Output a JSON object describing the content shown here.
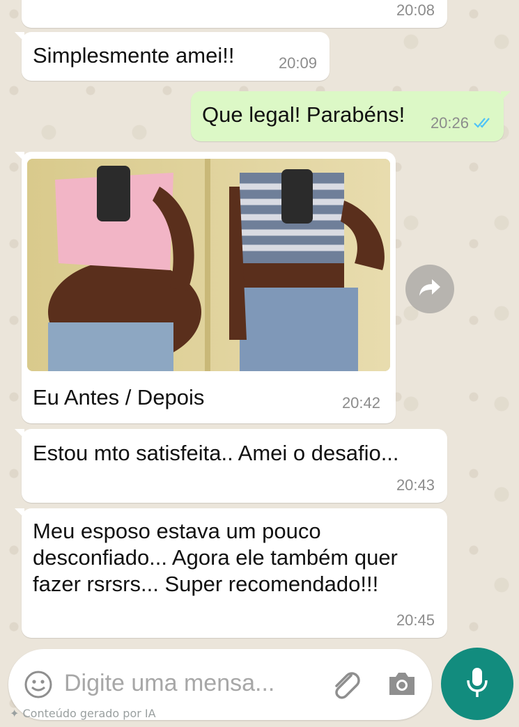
{
  "messages": [
    {
      "text": "",
      "time": "20:08"
    },
    {
      "text": "Simplesmente amei!!",
      "time": "20:09"
    },
    {
      "text": "Que legal! Parabéns!",
      "time": "20:26",
      "status_icon": "double-check-read-icon",
      "status_color": "#4fc3f7"
    },
    {
      "caption": "Eu Antes / Depois",
      "time": "20:42"
    },
    {
      "text": "Estou mto satisfeita.. Amei o desafio...",
      "time": "20:43"
    },
    {
      "lines": [
        "Meu esposo estava um pouco",
        "desconfiado... Agora ele também quer",
        "fazer rsrsrs... Super recomendado!!!"
      ],
      "time": "20:45"
    }
  ],
  "composer": {
    "placeholder": "Digite uma mensa...",
    "emoji_icon": "emoji-icon",
    "attach_icon": "paperclip-icon",
    "camera_icon": "camera-icon",
    "mic_icon": "microphone-icon"
  },
  "forward_icon": "forward-arrow-icon",
  "footer_note": "Conteúdo gerado por IA",
  "colors": {
    "outgoing_bubble": "#dcf8c6",
    "incoming_bubble": "#ffffff",
    "accent": "#128c7e",
    "read_ticks": "#4fc3f7"
  }
}
